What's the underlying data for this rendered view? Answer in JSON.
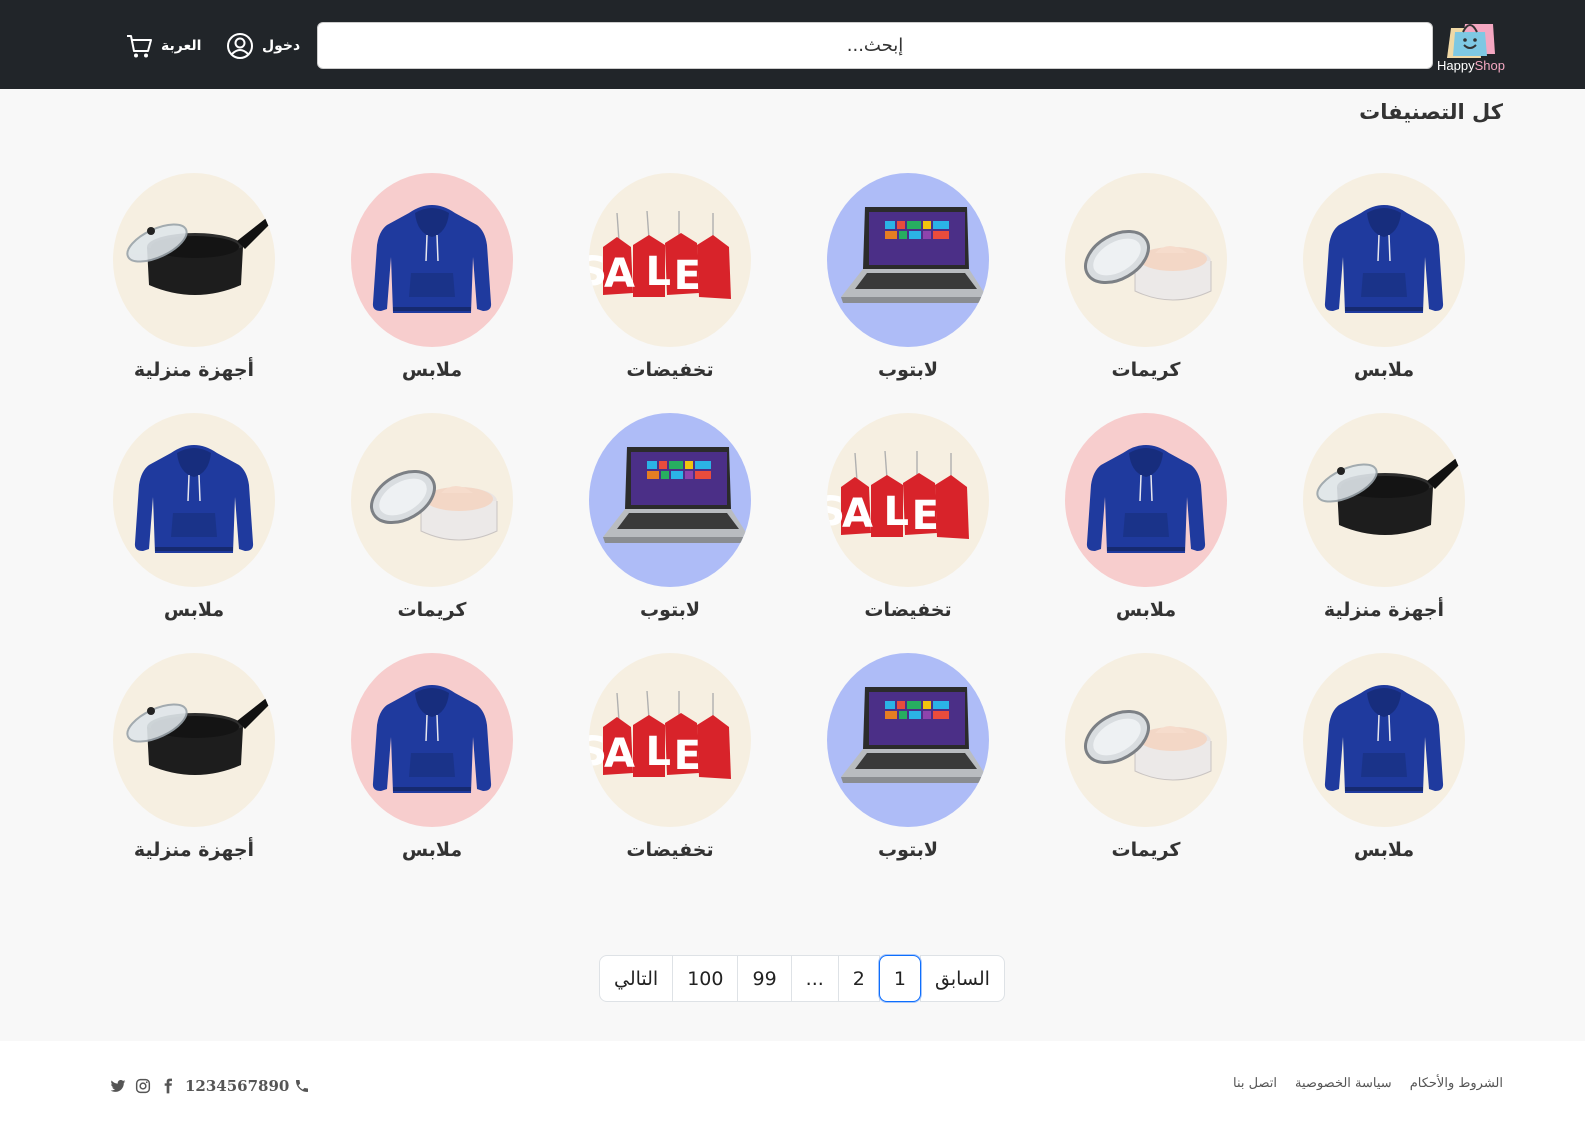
{
  "header": {
    "logo": {
      "part1": "Happy",
      "part2": "Shop"
    },
    "search_placeholder": "إبحث...",
    "login_label": "دخول",
    "cart_label": "العربة"
  },
  "page_title": "كل التصنيفات",
  "categories": [
    {
      "label": "ملابس",
      "image": "hoodie",
      "bg": "#f6efe1"
    },
    {
      "label": "كريمات",
      "image": "cream-jar",
      "bg": "#f6efe1"
    },
    {
      "label": "لابتوب",
      "image": "laptop",
      "bg": "#aebcf7"
    },
    {
      "label": "تخفيضات",
      "image": "sale-tags",
      "bg": "#f6efe1"
    },
    {
      "label": "ملابس",
      "image": "hoodie",
      "bg": "#f7cdcd"
    },
    {
      "label": "أجهزة منزلية",
      "image": "cooking-pot",
      "bg": "#f6efe1"
    },
    {
      "label": "أجهزة منزلية",
      "image": "cooking-pot",
      "bg": "#f6efe1"
    },
    {
      "label": "ملابس",
      "image": "hoodie",
      "bg": "#f7cdcd"
    },
    {
      "label": "تخفيضات",
      "image": "sale-tags",
      "bg": "#f6efe1"
    },
    {
      "label": "لابتوب",
      "image": "laptop",
      "bg": "#aebcf7"
    },
    {
      "label": "كريمات",
      "image": "cream-jar",
      "bg": "#f6efe1"
    },
    {
      "label": "ملابس",
      "image": "hoodie",
      "bg": "#f6efe1"
    },
    {
      "label": "ملابس",
      "image": "hoodie",
      "bg": "#f6efe1"
    },
    {
      "label": "كريمات",
      "image": "cream-jar",
      "bg": "#f6efe1"
    },
    {
      "label": "لابتوب",
      "image": "laptop",
      "bg": "#aebcf7"
    },
    {
      "label": "تخفيضات",
      "image": "sale-tags",
      "bg": "#f6efe1"
    },
    {
      "label": "ملابس",
      "image": "hoodie",
      "bg": "#f7cdcd"
    },
    {
      "label": "أجهزة منزلية",
      "image": "cooking-pot",
      "bg": "#f6efe1"
    }
  ],
  "pagination": {
    "prev": "السابق",
    "pages": [
      "1",
      "2",
      "...",
      "99",
      "100"
    ],
    "active": "1",
    "next": "التالي"
  },
  "footer": {
    "links": [
      "الشروط والأحكام",
      "سياسة الخصوصية",
      "اتصل بنا"
    ],
    "phone": "1234567890",
    "social_icons": [
      "facebook-icon",
      "instagram-icon",
      "twitter-icon"
    ]
  },
  "colors": {
    "header_bg": "#212529",
    "accent": "#0d6efd",
    "hoodie_blue": "#1f3a9e",
    "sale_red": "#d8232a"
  }
}
